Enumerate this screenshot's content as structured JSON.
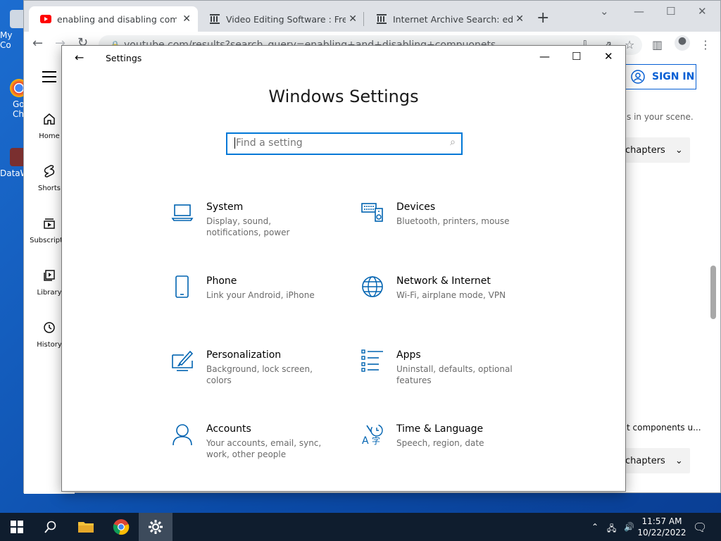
{
  "desktop": {
    "icons": [
      {
        "label": "My Co",
        "name": "my-computer-icon"
      },
      {
        "label": "Go\nCh",
        "name": "google-chrome-desktop-icon"
      },
      {
        "label": "DataW",
        "name": "datawrangler-desktop-icon"
      }
    ]
  },
  "browser": {
    "tabs": [
      {
        "title": "enabling and disabling compuo",
        "icon": "youtube-icon",
        "active": true
      },
      {
        "title": "Video Editing Software : Free Do",
        "icon": "archive-icon",
        "active": false
      },
      {
        "title": "Internet Archive Search: editor w",
        "icon": "archive-icon",
        "active": false
      }
    ],
    "url": "youtube.com/results?search_query=enabling+and+disabling+compuonets"
  },
  "youtube": {
    "nav": [
      {
        "label": "Home",
        "icon": "home-icon"
      },
      {
        "label": "Shorts",
        "icon": "shorts-icon"
      },
      {
        "label": "Subscriptio",
        "icon": "subscriptions-icon"
      },
      {
        "label": "Library",
        "icon": "library-icon"
      },
      {
        "label": "History",
        "icon": "history-icon"
      }
    ],
    "sign_in": "SIGN IN",
    "snippet1": "s in your scene.",
    "chapters_label": "chapters",
    "snippet2": "t components u..."
  },
  "settings": {
    "window_title": "Settings",
    "heading": "Windows Settings",
    "search_placeholder": "Find a setting",
    "categories": [
      {
        "name": "System",
        "desc": "Display, sound, notifications, power",
        "icon": "laptop-icon"
      },
      {
        "name": "Devices",
        "desc": "Bluetooth, printers, mouse",
        "icon": "devices-icon"
      },
      {
        "name": "Phone",
        "desc": "Link your Android, iPhone",
        "icon": "phone-icon"
      },
      {
        "name": "Network & Internet",
        "desc": "Wi-Fi, airplane mode, VPN",
        "icon": "globe-icon"
      },
      {
        "name": "Personalization",
        "desc": "Background, lock screen, colors",
        "icon": "personalization-icon"
      },
      {
        "name": "Apps",
        "desc": "Uninstall, defaults, optional features",
        "icon": "apps-icon"
      },
      {
        "name": "Accounts",
        "desc": "Your accounts, email, sync, work, other people",
        "icon": "person-icon"
      },
      {
        "name": "Time & Language",
        "desc": "Speech, region, date",
        "icon": "time-language-icon"
      }
    ]
  },
  "taskbar": {
    "time": "11:57 AM",
    "date": "10/22/2022"
  },
  "colors": {
    "accent": "#0078d7",
    "taskbar": "#0f1d2e",
    "desktop": "#1c6dd0"
  }
}
